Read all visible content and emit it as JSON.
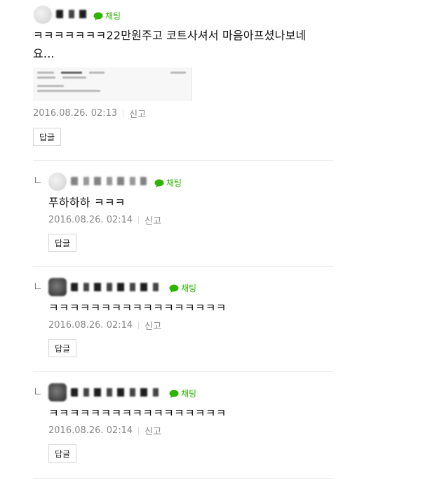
{
  "comments": [
    {
      "chat_label": "채팅",
      "text": "ㅋㅋㅋㅋㅋㅋㅋ22만원주고 코트사셔서 마음아프셨나보네요...",
      "date": "2016.08.26. 02:13",
      "report": "신고",
      "reply_button": "답글",
      "is_reply": false
    },
    {
      "chat_label": "채팅",
      "text": "푸하하하 ㅋㅋㅋ",
      "date": "2016.08.26. 02:14",
      "report": "신고",
      "reply_button": "답글",
      "is_reply": true
    },
    {
      "chat_label": "채팅",
      "text": "ㅋㅋㅋㅋㅋㅋㅋㅋㅋㅋㅋㅋㅋㅋㅋㅋㅋ",
      "date": "2016.08.26. 02:14",
      "report": "신고",
      "reply_button": "답글",
      "is_reply": true
    },
    {
      "chat_label": "채팅",
      "text": "ㅋㅋㅋㅋㅋㅋㅋㅋㅋㅋㅋㅋㅋㅋㅋㅋㅋ",
      "date": "2016.08.26. 02:14",
      "report": "신고",
      "reply_button": "답글",
      "is_reply": true
    }
  ],
  "colors": {
    "chat_green": "#2db400",
    "meta_gray": "#888888"
  },
  "icons": {
    "chat": "speech-bubble-icon",
    "reply": "reply-arrow-icon",
    "avatar": "avatar"
  }
}
